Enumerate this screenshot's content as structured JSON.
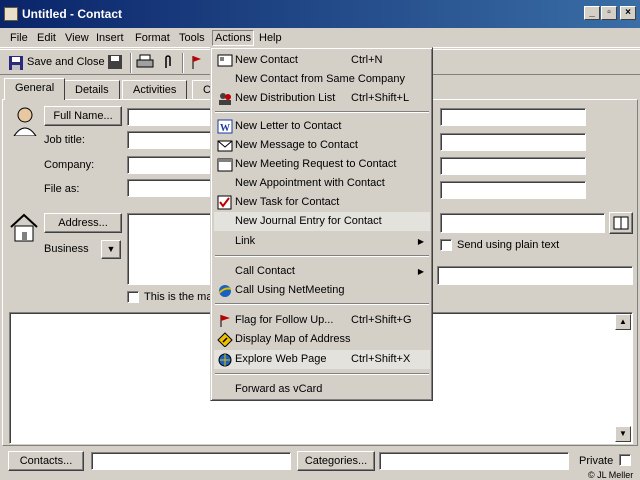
{
  "window": {
    "title": "Untitled - Contact"
  },
  "menubar": {
    "file": "File",
    "edit": "Edit",
    "view": "View",
    "insert": "Insert",
    "format": "Format",
    "tools": "Tools",
    "actions": "Actions",
    "help": "Help"
  },
  "toolbar": {
    "save_close": "Save and Close"
  },
  "tabs": {
    "general": "General",
    "details": "Details",
    "activities": "Activities",
    "certificates": "C"
  },
  "form": {
    "full_name_button": "Full Name...",
    "job_title_label": "Job title:",
    "company_label": "Company:",
    "file_as_label": "File as:",
    "address_button": "Address...",
    "address_type": "Business",
    "mailing_address_checkbox": "This is the mai",
    "send_plain_text": "Send using plain text"
  },
  "actions_menu": {
    "items": [
      {
        "label": "New Contact",
        "shortcut": "Ctrl+N",
        "icon": "new-contact-icon"
      },
      {
        "label": "New Contact from Same Company",
        "shortcut": "",
        "icon": ""
      },
      {
        "label": "New Distribution List",
        "shortcut": "Ctrl+Shift+L",
        "icon": "distribution-list-icon"
      },
      {
        "label": "New Letter to Contact",
        "shortcut": "",
        "icon": "word-icon"
      },
      {
        "label": "New Message to Contact",
        "shortcut": "",
        "icon": "message-icon"
      },
      {
        "label": "New Meeting Request to Contact",
        "shortcut": "",
        "icon": "meeting-icon"
      },
      {
        "label": "New Appointment with Contact",
        "shortcut": "",
        "icon": ""
      },
      {
        "label": "New Task for Contact",
        "shortcut": "",
        "icon": "task-icon"
      },
      {
        "label": "New Journal Entry for Contact",
        "shortcut": "",
        "icon": ""
      },
      {
        "label": "Link",
        "shortcut": "",
        "icon": ""
      },
      {
        "label": "Call Contact",
        "shortcut": "",
        "icon": ""
      },
      {
        "label": "Call Using NetMeeting",
        "shortcut": "",
        "icon": "netmeeting-icon"
      },
      {
        "label": "Flag for Follow Up...",
        "shortcut": "Ctrl+Shift+G",
        "icon": "flag-icon"
      },
      {
        "label": "Display Map of Address",
        "shortcut": "",
        "icon": "map-icon"
      },
      {
        "label": "Explore Web Page",
        "shortcut": "Ctrl+Shift+X",
        "icon": "web-page-icon"
      },
      {
        "label": "Forward as vCard",
        "shortcut": "",
        "icon": ""
      }
    ]
  },
  "footer": {
    "contacts_button": "Contacts...",
    "categories_button": "Categories...",
    "private_label": "Private",
    "credit": "© JL Meller"
  }
}
